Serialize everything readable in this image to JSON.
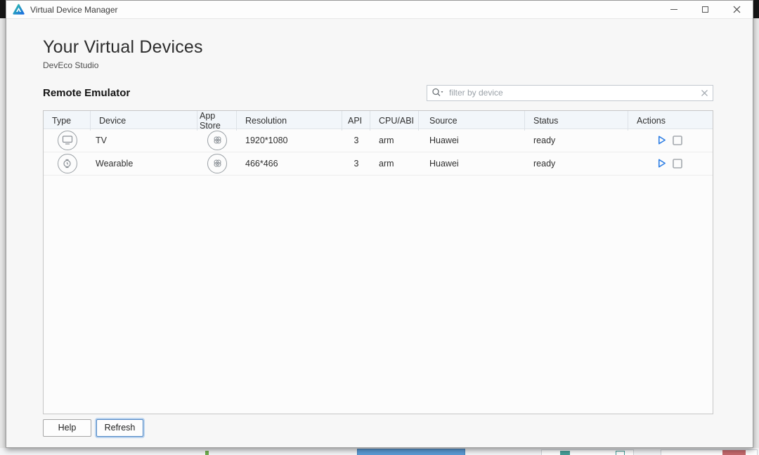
{
  "window": {
    "title": "Virtual Device Manager",
    "controls": {
      "minimize": "minimize",
      "maximize": "maximize",
      "close": "close"
    }
  },
  "header": {
    "title": "Your Virtual Devices",
    "subtitle": "DevEco Studio"
  },
  "section": {
    "title": "Remote Emulator"
  },
  "filter": {
    "placeholder": "filter by device",
    "value": ""
  },
  "table": {
    "columns": [
      "Type",
      "Device",
      "App Store",
      "Resolution",
      "API",
      "CPU/ABI",
      "Source",
      "Status",
      "Actions"
    ],
    "rows": [
      {
        "type_icon": "tv-icon",
        "device": "TV",
        "app_store_icon": "appgallery-icon",
        "resolution": "1920*1080",
        "api": "3",
        "cpu_abi": "arm",
        "source": "Huawei",
        "status": "ready",
        "actions": [
          "run-icon",
          "stop-checkbox"
        ]
      },
      {
        "type_icon": "watch-icon",
        "device": "Wearable",
        "app_store_icon": "appgallery-icon",
        "resolution": "466*466",
        "api": "3",
        "cpu_abi": "arm",
        "source": "Huawei",
        "status": "ready",
        "actions": [
          "run-icon",
          "stop-checkbox"
        ]
      }
    ]
  },
  "footer": {
    "help_label": "Help",
    "refresh_label": "Refresh"
  },
  "colors": {
    "logo_teal": "#2fc4a8",
    "logo_blue": "#1a6ce0",
    "play_blue": "#2e7ee4",
    "refresh_border": "#4f87c4",
    "table_header_bg": "#f2f6fa",
    "window_bg": "#f7f7f7",
    "status_text": "#2f2f2f",
    "placeholder": "#9aa1a8",
    "desktop_topbar": "#161616"
  }
}
